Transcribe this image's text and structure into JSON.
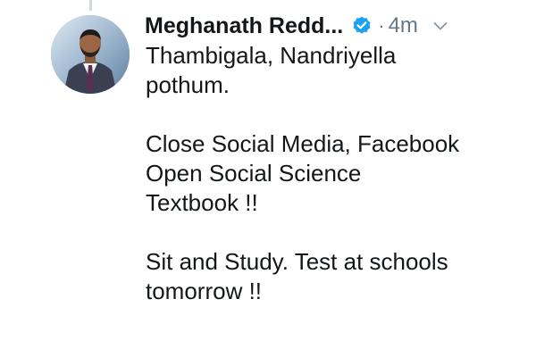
{
  "tweet": {
    "author": {
      "display_name": "Meghanath Redd...",
      "verified": true,
      "avatar_icon": "profile-photo-man-in-suit"
    },
    "separator": "·",
    "timestamp": "4m",
    "menu_icon": "chevron-down-icon",
    "lines": [
      "Thambigala, Nandriyella",
      "pothum.",
      "",
      "Close Social Media, Facebook",
      "Open Social Science",
      "Textbook !!",
      "",
      "Sit and Study. Test at schools",
      "tomorrow !!"
    ]
  },
  "colors": {
    "text_primary": "#14171a",
    "text_secondary": "#657786",
    "verified_badge": "#1da1f2",
    "thread_line": "#cfd9de"
  }
}
